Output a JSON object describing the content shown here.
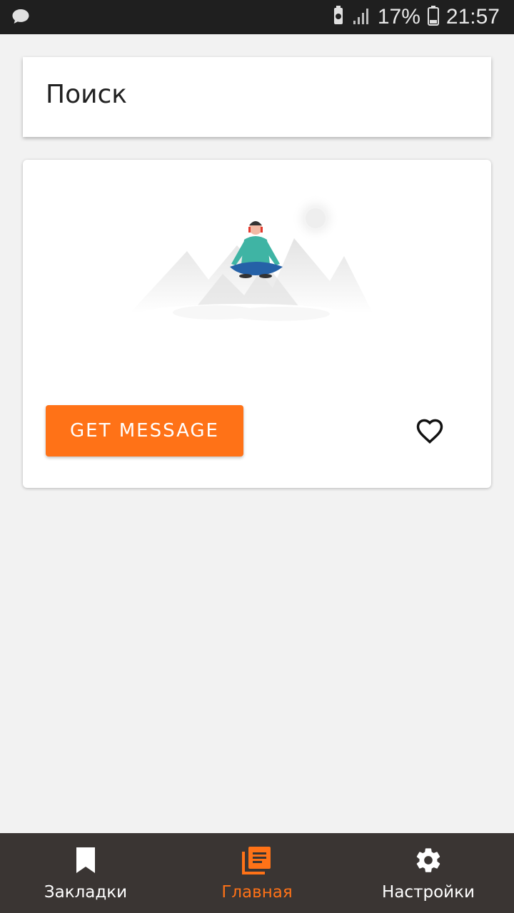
{
  "status_bar": {
    "battery_percent": "17%",
    "time": "21:57",
    "icons": [
      "chat-notification-icon",
      "battery-saver-icon",
      "signal-icon",
      "battery-icon"
    ]
  },
  "search": {
    "label": "Поиск"
  },
  "card": {
    "illustration": "meditating-person-on-mountain",
    "button_label": "GET MESSAGE",
    "favorite_icon": "heart-outline-icon"
  },
  "bottom_nav": {
    "items": [
      {
        "label": "Закладки",
        "icon": "bookmark-icon",
        "active": false
      },
      {
        "label": "Главная",
        "icon": "library-icon",
        "active": true
      },
      {
        "label": "Настройки",
        "icon": "gear-icon",
        "active": false
      }
    ]
  },
  "colors": {
    "accent": "#ff7217",
    "nav_background": "#3a3533",
    "status_bar": "#1f1f1f",
    "page_background": "#f2f2f2"
  }
}
